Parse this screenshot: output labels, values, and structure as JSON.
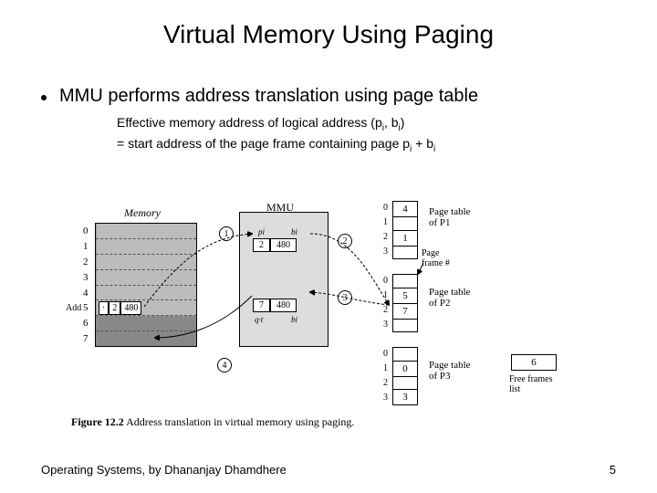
{
  "title": "Virtual Memory Using Paging",
  "bullet": "MMU performs address translation using page table",
  "subtext_line1_pre": "Effective memory address of logical address (p",
  "subtext_line1_mid": ", b",
  "subtext_line1_post": ")",
  "subtext_line2_pre": "= start address of the page frame containing page p",
  "subtext_line2_mid": " + b",
  "memory_label": "Memory",
  "mmu_label": "MMU",
  "memory_rows": [
    "0",
    "1",
    "2",
    "3",
    "4",
    "5",
    "6",
    "7"
  ],
  "add_label": "Add",
  "add_cell_dash": "·",
  "add_cell_p": "2",
  "add_cell_b": "480",
  "mmu_pi": "pi",
  "mmu_bi": "bi",
  "mmu_row1_p": "2",
  "mmu_row1_b": "480",
  "mmu_row2_p": "7",
  "mmu_row2_b": "480",
  "mmu_qt": "q·t",
  "mmu_bi2": "bi",
  "pt1_index": [
    "0",
    "1",
    "2",
    "3"
  ],
  "pt1_vals": [
    "4",
    "",
    "1",
    ""
  ],
  "pt1_label": "Page table\nof P1",
  "pageframe_label": "Page\nframe #",
  "pt2_index": [
    "0",
    "1",
    "2",
    "3"
  ],
  "pt2_vals": [
    "",
    "5",
    "7",
    ""
  ],
  "pt2_label": "Page table\nof P2",
  "pt3_index": [
    "0",
    "1",
    "2",
    "3"
  ],
  "pt3_vals": [
    "",
    "0",
    "",
    "3"
  ],
  "pt3_label": "Page table\nof P3",
  "free_val": "6",
  "free_label": "Free frames\nlist",
  "circ1": "1",
  "circ2": "2",
  "circ3": "3",
  "circ4": "4",
  "caption_bold": "Figure 12.2",
  "caption_rest": "  Address translation in virtual memory using paging.",
  "footer_left": "Operating Systems, by Dhananjay Dhamdhere",
  "footer_right": "5",
  "sub_i": "i"
}
